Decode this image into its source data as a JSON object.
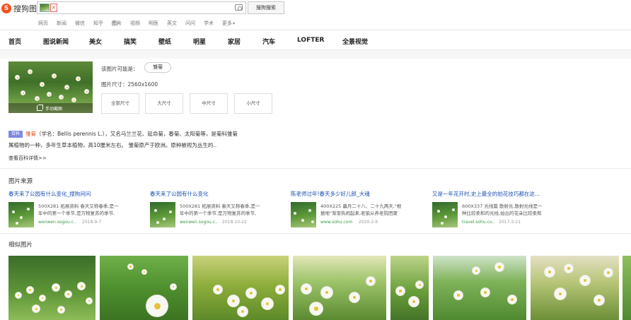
{
  "header": {
    "logo_text": "搜狗图片",
    "clear_label": "×",
    "search_button": "搜狗搜索"
  },
  "vertical_tabs": [
    "网页",
    "新闻",
    "微信",
    "知乎",
    "图片",
    "视频",
    "明医",
    "英文",
    "问问",
    "学术",
    "更多"
  ],
  "active_vertical_tab": "图片",
  "categories": [
    "首页",
    "图说新闻",
    "美女",
    "搞笑",
    "壁纸",
    "明星",
    "家居",
    "汽车",
    "LOFTER",
    "全景视觉"
  ],
  "image_info": {
    "crop_label": "手动截图",
    "maybe_label": "该图片可能是：",
    "maybe_tag": "雏菊",
    "size_label": "图片尺寸：2560x1600",
    "size_buttons": [
      "全部尺寸",
      "大尺寸",
      "中尺寸",
      "小尺寸"
    ]
  },
  "baike": {
    "badge": "百科",
    "name": "雏菊",
    "line1_rest": "（学名：Bellis perennis L.），又名马兰兰花、延命菊，春菊、太阳菊等，是菊科雏菊",
    "line2": "属植物的一种，多年生草本植物，高10厘米左右。 雏菊原产于欧洲。原种被视为丛生的..",
    "more_link": "查看百科详情>>"
  },
  "sources": {
    "title": "图片来源",
    "items": [
      {
        "title": "春天来了公园有什么变化_搜狗问问",
        "desc_line1": "500X281 拓展资料 春天又称春季,是一",
        "desc_line2": "年中的第一个季节,是万物复苏的季节,",
        "site": "wenwen.sogou.c..",
        "date": "2018-9-7"
      },
      {
        "title": "春天来了公园有什么变化",
        "desc_line1": "500X281 拓展资料 春天又称春季,是一",
        "desc_line2": "年中的第一个季节,是万物复苏的季节,",
        "site": "wenwen.sogou.c..",
        "date": "2018-10-22"
      },
      {
        "title": "陈老师过年!春天多少好儿郎_大魂",
        "desc_line1": "400X225 暮月二十八、二十九两天,\"根",
        "desc_line2": "据地\"渐渐热闹起来,老狼从养老院团聚",
        "site": "www.sohu.com",
        "date": "2020-2-6"
      },
      {
        "title": "又是一年花开时,史上最全的拍花技巧都在这...",
        "desc_line1": "600X337 光线篇 散射光,散射光线是一",
        "desc_line2": "种比较柔和的光线,拍出的花朵比较柔和",
        "site": "travel.sohu.co..",
        "date": "2017-3-21"
      }
    ]
  },
  "similar": {
    "title": "相似图片"
  }
}
